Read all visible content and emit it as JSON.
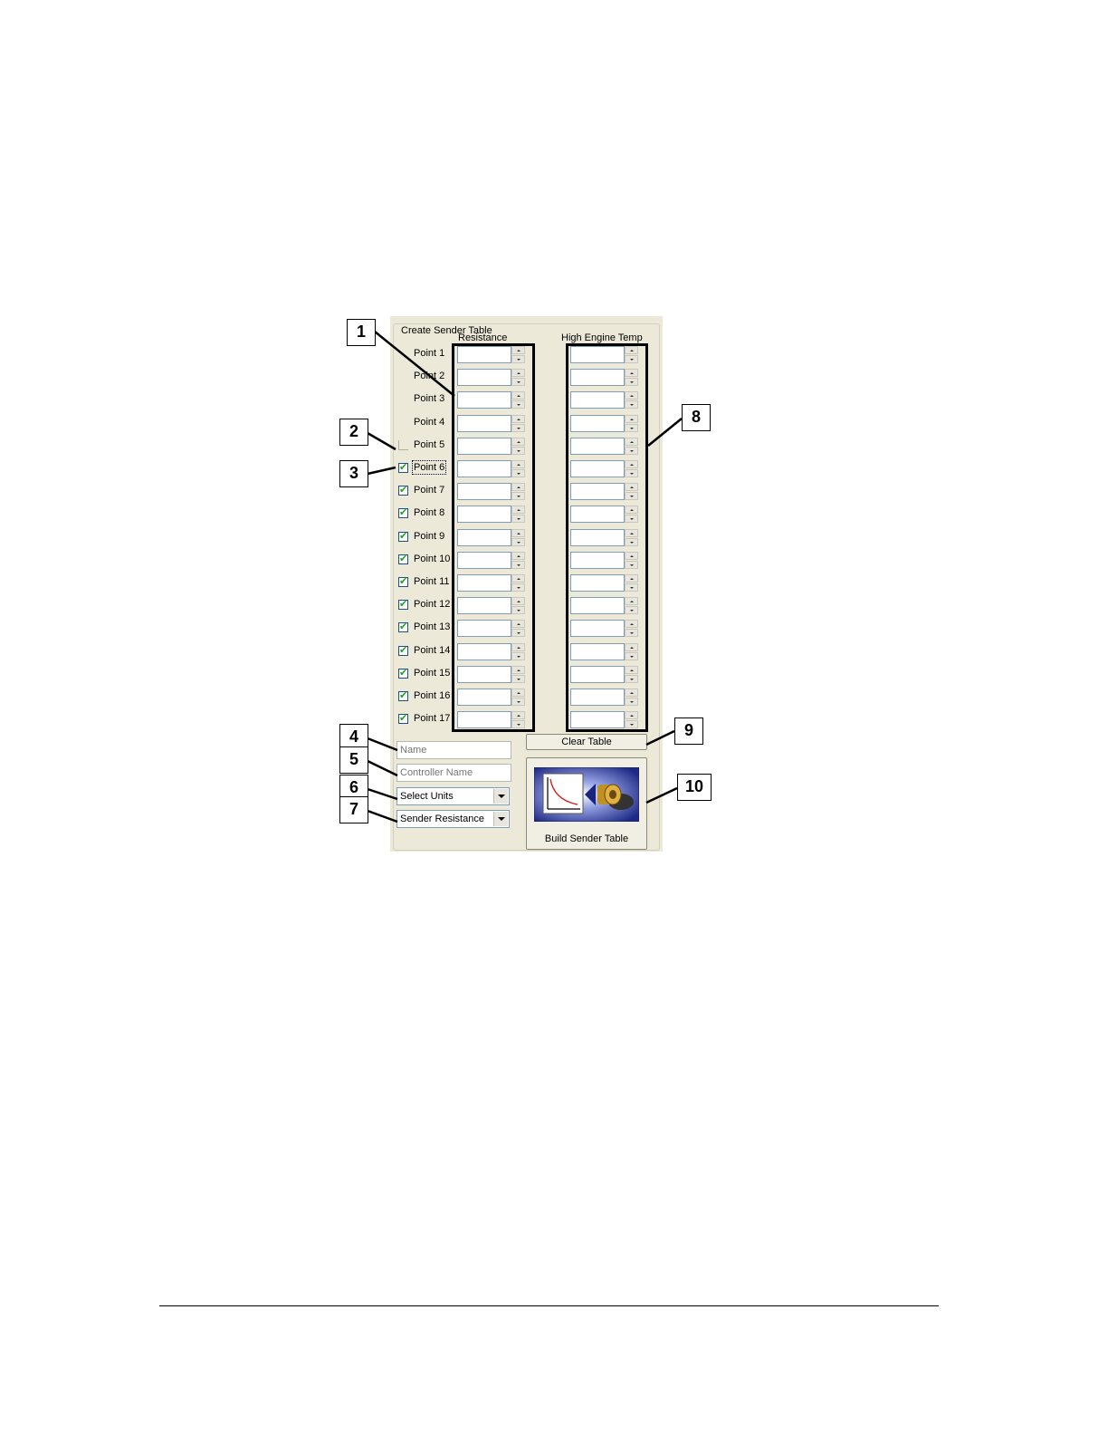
{
  "panel": {
    "group_title": "Create Sender Table",
    "columns": {
      "resistance": "Resistance",
      "temp": "High Engine Temp"
    },
    "points": [
      {
        "label": "Point 1",
        "checkbox": "hidden"
      },
      {
        "label": "Point 2",
        "checkbox": "hidden"
      },
      {
        "label": "Point 3",
        "checkbox": "hidden"
      },
      {
        "label": "Point 4",
        "checkbox": "hidden"
      },
      {
        "label": "Point 5",
        "checkbox": "disabled"
      },
      {
        "label": "Point 6",
        "checkbox": "checked",
        "focused": true
      },
      {
        "label": "Point 7",
        "checkbox": "checked"
      },
      {
        "label": "Point 8",
        "checkbox": "checked"
      },
      {
        "label": "Point 9",
        "checkbox": "checked"
      },
      {
        "label": "Point 10",
        "checkbox": "checked"
      },
      {
        "label": "Point 11",
        "checkbox": "checked"
      },
      {
        "label": "Point 12",
        "checkbox": "checked"
      },
      {
        "label": "Point 13",
        "checkbox": "checked"
      },
      {
        "label": "Point 14",
        "checkbox": "checked"
      },
      {
        "label": "Point 15",
        "checkbox": "checked"
      },
      {
        "label": "Point 16",
        "checkbox": "checked"
      },
      {
        "label": "Point 17",
        "checkbox": "checked"
      }
    ],
    "clear_button": "Clear Table",
    "name_placeholder": "Name",
    "controller_placeholder": "Controller Name",
    "units_select": "Select Units",
    "type_select": "Sender Resistance",
    "build_button": "Build Sender Table"
  },
  "callouts": [
    "1",
    "2",
    "3",
    "4",
    "5",
    "6",
    "7",
    "8",
    "9",
    "10"
  ],
  "colors": {
    "panel_bg": "#ece9d8",
    "field_border": "#7f9db9",
    "check": "#21a121",
    "icon_bg": "#2a2f8a"
  },
  "icons": {
    "checkbox_mark": "checkmark-icon",
    "build": "graph-and-engine-icon"
  }
}
